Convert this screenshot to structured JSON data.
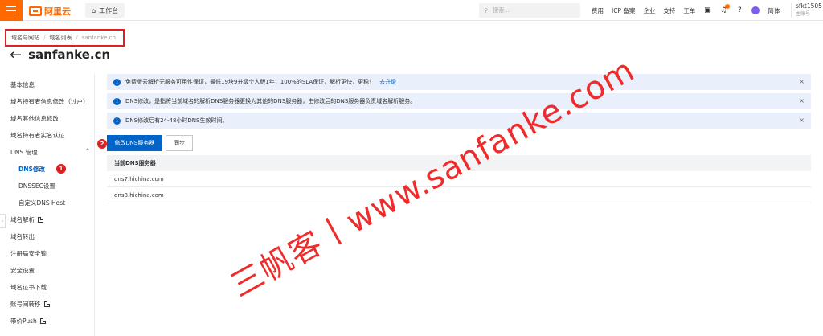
{
  "topbar": {
    "logo": "阿里云",
    "workbench": "工作台",
    "search_placeholder": "搜索...",
    "nav": [
      "费用",
      "ICP 备案",
      "企业",
      "支持",
      "工单"
    ],
    "lang": "简体",
    "user_name": "sfkt1505",
    "user_sub": "主账号"
  },
  "breadcrumb": {
    "items": [
      "域名与网站",
      "域名列表"
    ],
    "current": "sanfanke.cn"
  },
  "page": {
    "title": "sanfanke.cn",
    "back": "←"
  },
  "sidebar": {
    "items": [
      {
        "label": "基本信息"
      },
      {
        "label": "域名持有者信息修改（过户）"
      },
      {
        "label": "域名其他信息修改"
      },
      {
        "label": "域名持有者实名认证"
      },
      {
        "label": "DNS 管理"
      },
      {
        "label": "DNS修改"
      },
      {
        "label": "DNSSEC设置"
      },
      {
        "label": "自定义DNS Host"
      },
      {
        "label": "域名解析"
      },
      {
        "label": "域名转出"
      },
      {
        "label": "注册局安全锁"
      },
      {
        "label": "安全设置"
      },
      {
        "label": "域名证书下载"
      },
      {
        "label": "账号间转移"
      },
      {
        "label": "带价Push"
      }
    ],
    "marker1": "1"
  },
  "notices": [
    {
      "text": "免费版云解析无服务可用性保证，最低19块9升级个人版1年，100%的SLA保证，解析更快，更稳！",
      "link": "去升级"
    },
    {
      "text": "DNS修改，是指将当前域名的解析DNS服务器更换为其他的DNS服务器，由修改后的DNS服务器负责域名解析服务。"
    },
    {
      "text": "DNS修改后有24-48小时DNS生效时间。"
    }
  ],
  "actions": {
    "modify": "修改DNS服务器",
    "sync": "同步",
    "marker2": "2"
  },
  "table": {
    "header": "当前DNS服务器",
    "rows": [
      "dns7.hichina.com",
      "dns8.hichina.com"
    ]
  },
  "watermark": "三帆客丨www.sanfanke.com",
  "colors": {
    "accent": "#ff6a00",
    "primary": "#0064c8",
    "marker": "#e02020"
  }
}
